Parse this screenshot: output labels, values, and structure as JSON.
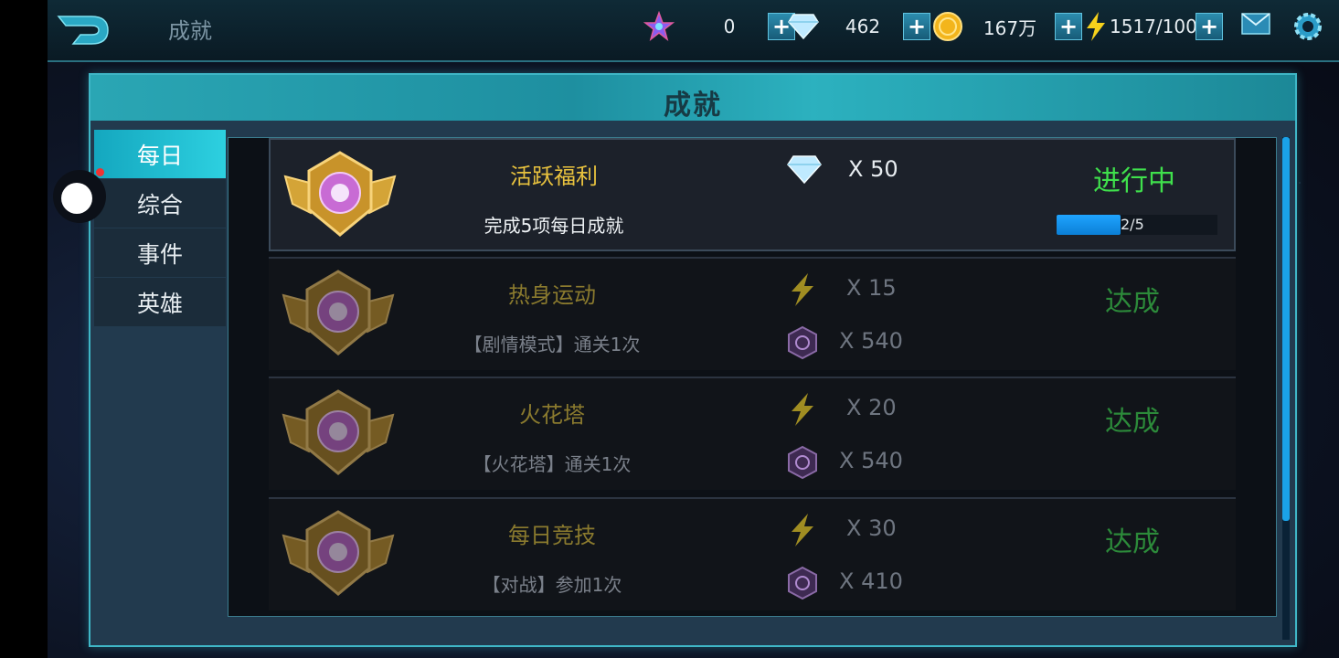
{
  "header": {
    "title": "成就",
    "resources": [
      {
        "icon": "star-gem-icon",
        "value": "0"
      },
      {
        "icon": "diamond-icon",
        "value": "462"
      },
      {
        "icon": "gold-coin-icon",
        "value": "167万"
      },
      {
        "icon": "lightning-icon",
        "value": "1517/100"
      }
    ]
  },
  "panel": {
    "title": "成就"
  },
  "tabs": [
    {
      "label": "每日",
      "active": true
    },
    {
      "label": "综合"
    },
    {
      "label": "事件"
    },
    {
      "label": "英雄"
    }
  ],
  "achievements": [
    {
      "name": "活跃福利",
      "desc": "完成5项每日成就",
      "rewards": [
        {
          "icon": "diamond-icon",
          "amount": "X 50"
        }
      ],
      "status": "进行中",
      "progress_text": "2/5",
      "progress": 0.4
    },
    {
      "name": "热身运动",
      "desc": "【剧情模式】通关1次",
      "rewards": [
        {
          "icon": "lightning-icon",
          "amount": "X 15"
        },
        {
          "icon": "hex-token-icon",
          "amount": "X 540"
        }
      ],
      "status": "达成"
    },
    {
      "name": "火花塔",
      "desc": "【火花塔】通关1次",
      "rewards": [
        {
          "icon": "lightning-icon",
          "amount": "X 20"
        },
        {
          "icon": "hex-token-icon",
          "amount": "X 540"
        }
      ],
      "status": "达成"
    },
    {
      "name": "每日竞技",
      "desc": "【对战】参加1次",
      "rewards": [
        {
          "icon": "lightning-icon",
          "amount": "X 30"
        },
        {
          "icon": "hex-token-icon",
          "amount": "X 410"
        }
      ],
      "status": "达成"
    }
  ],
  "colors": {
    "accent": "#2dd0e0",
    "progress": "#1fa4ff",
    "status_active": "#3fe04c",
    "status_done": "#2c8a3a"
  }
}
